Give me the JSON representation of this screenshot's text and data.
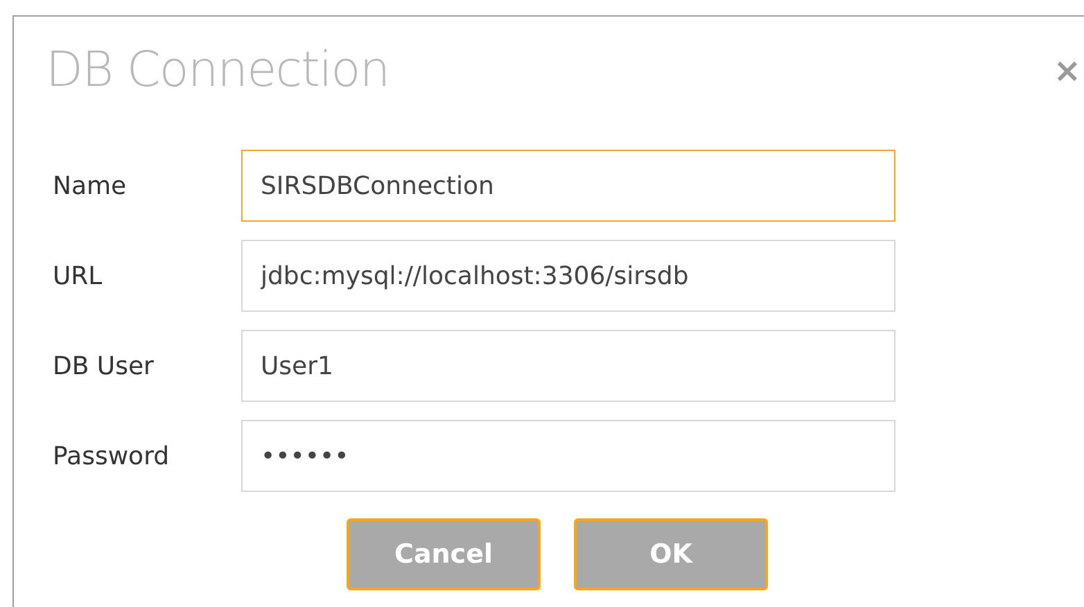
{
  "dialog": {
    "title": "DB Connection",
    "close": "×"
  },
  "fields": [
    {
      "label": "Name",
      "value": "SIRSDBConnection",
      "focused": true
    },
    {
      "label": "URL",
      "value": "jdbc:mysql://localhost:3306/sirsdb",
      "focused": false
    },
    {
      "label": "DB User",
      "value": "User1",
      "focused": false
    },
    {
      "label": "Password",
      "value": "••••••",
      "focused": false
    }
  ],
  "buttons": [
    "Cancel",
    "OK"
  ]
}
